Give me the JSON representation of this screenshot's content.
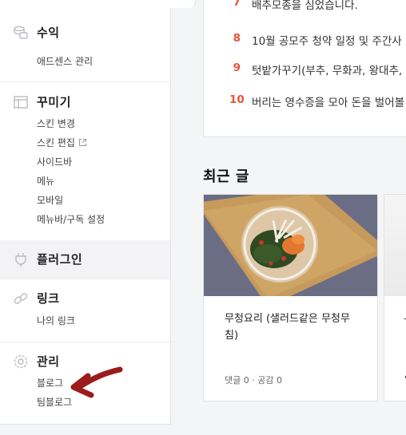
{
  "sidebar": {
    "sections": [
      {
        "id": "revenue",
        "title": "수익",
        "icon": "coins-icon",
        "items": [
          "애드센스 관리"
        ]
      },
      {
        "id": "decorate",
        "title": "꾸미기",
        "icon": "layout-icon",
        "items": [
          "스킨 변경",
          "스킨 편집",
          "사이드바",
          "메뉴",
          "모바일",
          "메뉴바/구독 설정"
        ]
      },
      {
        "id": "plugin",
        "title": "플러그인",
        "icon": "plug-icon",
        "items": []
      },
      {
        "id": "link",
        "title": "링크",
        "icon": "link-icon",
        "items": [
          "나의 링크"
        ]
      },
      {
        "id": "manage",
        "title": "관리",
        "icon": "gear-icon",
        "items": [
          "블로그",
          "팀블로그"
        ]
      }
    ],
    "external_icon": "external-link-icon",
    "active_section": "plugin"
  },
  "popular": {
    "rows": [
      {
        "num": "7",
        "text": "배추모종을 심었습니다."
      },
      {
        "num": "8",
        "text": "10월 공모주 청약 일정 및 주간사"
      },
      {
        "num": "9",
        "text": "텃밭가꾸기(부추, 무화과, 왕대추,"
      },
      {
        "num": "10",
        "text": "버리는 영수증을 모아 돈을 벌어볼"
      }
    ]
  },
  "recent": {
    "heading": "최근 글",
    "posts": [
      {
        "title": "무청요리 (샐러드같은 무청무침)",
        "meta": "댓글 0 · 공감 0"
      }
    ],
    "next_card_fragments": [
      "-",
      "•"
    ]
  },
  "colors": {
    "accent_number": "#e8543a",
    "active_bg": "#f3f3f5",
    "annotation_arrow": "#9b1c1c"
  }
}
